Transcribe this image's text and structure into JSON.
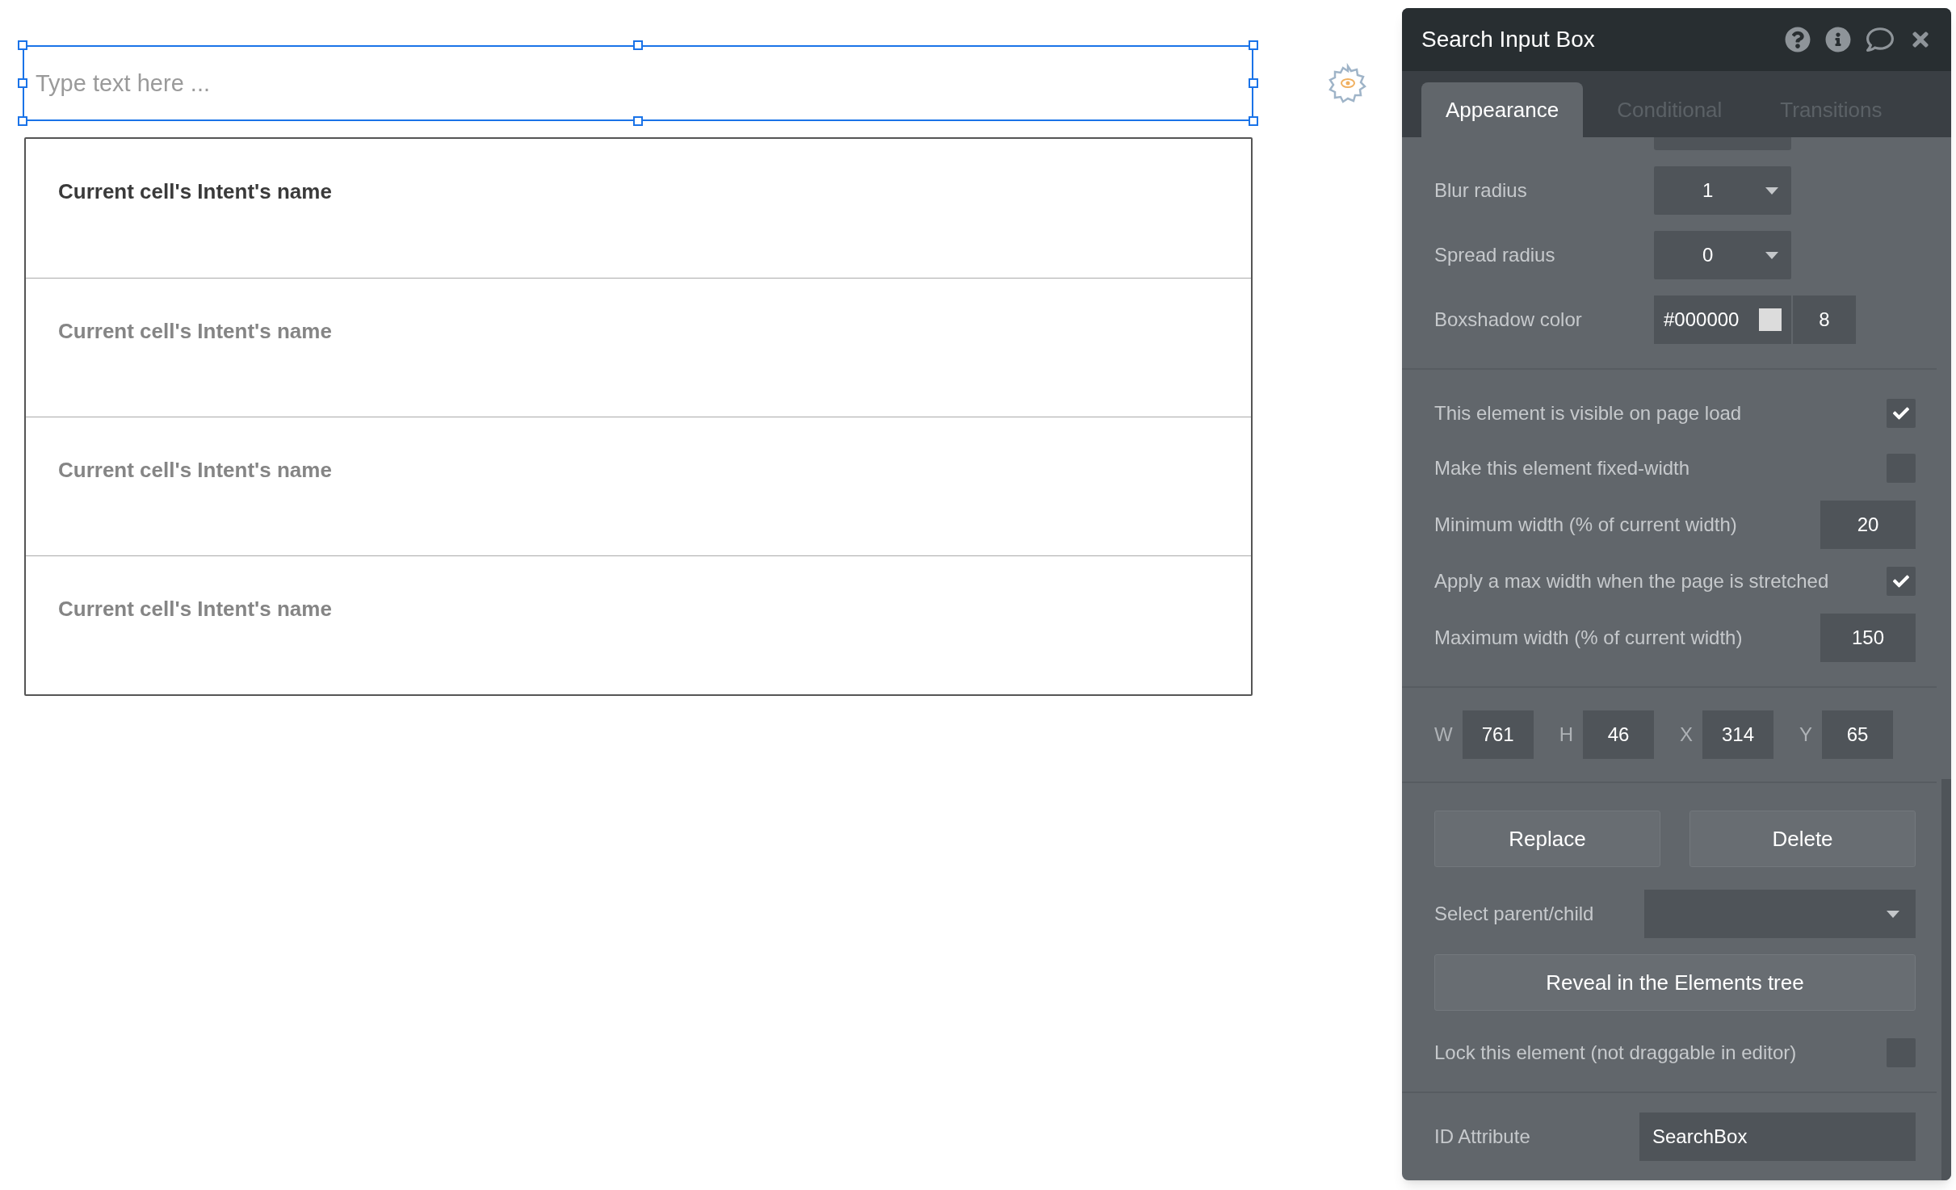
{
  "canvas": {
    "search_input": {
      "placeholder": "Type text here ...",
      "selected": true
    },
    "list_rows": [
      {
        "label": "Current cell's Intent's name",
        "selected": true
      },
      {
        "label": "Current cell's Intent's name",
        "selected": false
      },
      {
        "label": "Current cell's Intent's name",
        "selected": false
      },
      {
        "label": "Current cell's Intent's name",
        "selected": false
      }
    ]
  },
  "panel": {
    "title": "Search Input Box",
    "tabs": [
      {
        "label": "Appearance",
        "selected": true
      },
      {
        "label": "Conditional",
        "selected": false
      },
      {
        "label": "Transitions",
        "selected": false
      }
    ],
    "shadow_fields": [
      {
        "kind": "dropdown",
        "label": "Blur radius",
        "value": "1"
      },
      {
        "kind": "dropdown",
        "label": "Spread radius",
        "value": "0"
      },
      {
        "kind": "color",
        "label": "Boxshadow color",
        "value": "#000000",
        "opacity": "8"
      }
    ],
    "options": [
      {
        "kind": "checkbox",
        "label": "This element is visible on page load",
        "checked": true
      },
      {
        "kind": "checkbox",
        "label": "Make this element fixed-width",
        "checked": false
      },
      {
        "kind": "number",
        "label": "Minimum width (% of current width)",
        "value": "20"
      },
      {
        "kind": "checkbox",
        "label": "Apply a max width when the page is stretched",
        "checked": true
      },
      {
        "kind": "number",
        "label": "Maximum width (% of current width)",
        "value": "150"
      }
    ],
    "geometry": [
      {
        "label": "W",
        "value": "761"
      },
      {
        "label": "H",
        "value": "46"
      },
      {
        "label": "X",
        "value": "314"
      },
      {
        "label": "Y",
        "value": "65"
      }
    ],
    "buttons": [
      "Replace",
      "Delete"
    ],
    "parent_select": {
      "label": "Select parent/child"
    },
    "reveal_button": "Reveal in the Elements tree",
    "lock": {
      "label": "Lock this element (not draggable in editor)",
      "checked": false
    },
    "id_attribute": {
      "label": "ID Attribute",
      "value": "SearchBox"
    }
  }
}
